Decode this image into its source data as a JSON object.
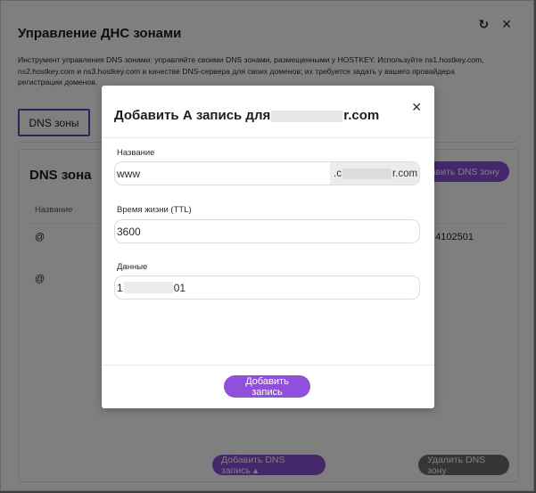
{
  "panel": {
    "title": "Управление ДНС зонами",
    "description": "Инструмент управления DNS зонами: управляйте своими DNS зонами, размещенными у HOSTKEY. Используйте ns1.hostkey.com, ns2.hostkey.com и ns3.hostkey.com в качестве DNS-сервера для своих доменов; их требуется задать у вашего провайдера регистрации доменов.",
    "refresh_icon": "↻",
    "close_icon": "✕",
    "tab_label": "DNS зоны"
  },
  "card": {
    "title": "DNS зона",
    "add_zone_label": "Добавить DNS зону",
    "column_name": "Название",
    "rows": [
      {
        "name": "@",
        "value": "4102501"
      },
      {
        "name": "@",
        "value": ""
      }
    ],
    "add_record_label": "Добавить DNS запись ▴",
    "delete_zone_label": "Удалить DNS зону"
  },
  "modal": {
    "title_prefix": "Добавить А запись для",
    "title_suffix": "r.com",
    "close_icon": "✕",
    "name_label": "Название",
    "name_value": "www",
    "name_suffix_prefix": ".c",
    "name_suffix_end": "r.com",
    "ttl_label": "Время жизни (TTL)",
    "ttl_value": "3600",
    "data_label": "Данные",
    "data_prefix": "1",
    "data_suffix": "01",
    "submit_label": "Добавить запись"
  },
  "colors": {
    "accent": "#9050db",
    "accent_border": "#6b3fb0",
    "overlay": "rgba(0,0,0,0.5)"
  }
}
